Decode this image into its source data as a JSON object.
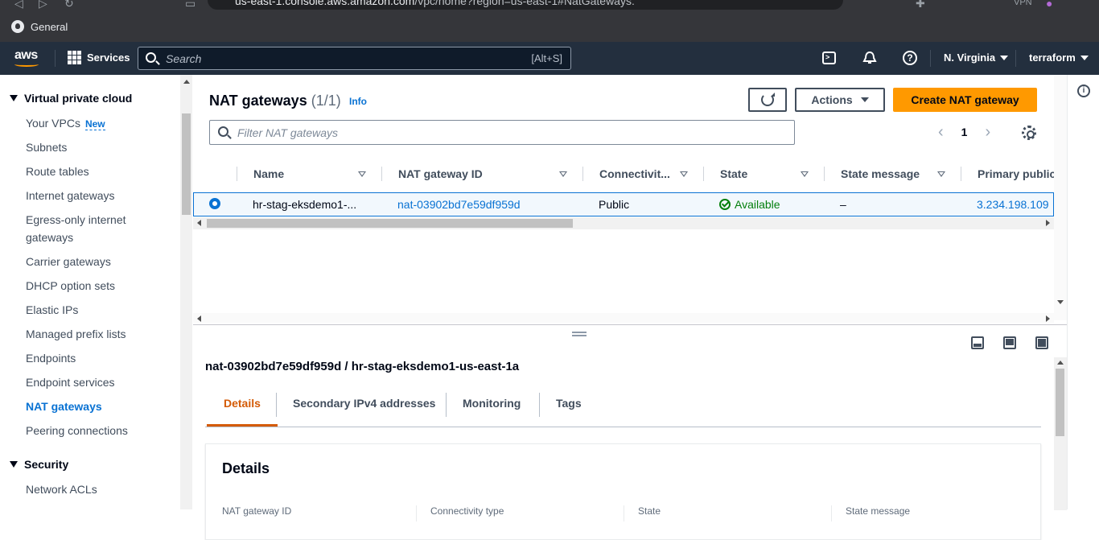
{
  "browser": {
    "url_host": "us-east-1.console.aws.amazon.com",
    "url_path": "/vpc/home?region=us-east-1#NatGateways:",
    "bookmark": "General",
    "vpn_label": "VPN"
  },
  "aws_nav": {
    "logo": "aws",
    "services": "Services",
    "search_placeholder": "Search",
    "search_shortcut": "[Alt+S]",
    "region": "N. Virginia",
    "account": "terraform"
  },
  "sidebar": {
    "section_vpc": "Virtual private cloud",
    "items": [
      {
        "label": "Your VPCs",
        "badge": "New"
      },
      {
        "label": "Subnets"
      },
      {
        "label": "Route tables"
      },
      {
        "label": "Internet gateways"
      },
      {
        "label": "Egress-only internet gateways"
      },
      {
        "label": "Carrier gateways"
      },
      {
        "label": "DHCP option sets"
      },
      {
        "label": "Elastic IPs"
      },
      {
        "label": "Managed prefix lists"
      },
      {
        "label": "Endpoints"
      },
      {
        "label": "Endpoint services"
      },
      {
        "label": "NAT gateways"
      },
      {
        "label": "Peering connections"
      }
    ],
    "section_security": "Security",
    "security_items": [
      {
        "label": "Network ACLs"
      }
    ]
  },
  "main": {
    "title": "NAT gateways",
    "count": "(1/1)",
    "info": "Info",
    "actions_label": "Actions",
    "create_label": "Create NAT gateway",
    "filter_placeholder": "Filter NAT gateways",
    "page_number": "1",
    "columns": [
      "Name",
      "NAT gateway ID",
      "Connectivit...",
      "State",
      "State message",
      "Primary public"
    ],
    "rows": [
      {
        "name": "hr-stag-eksdemo1-...",
        "id": "nat-03902bd7e59df959d",
        "connectivity": "Public",
        "state": "Available",
        "state_message": "–",
        "primary_public_ip": "3.234.198.109"
      }
    ]
  },
  "split_panel": {
    "title": "nat-03902bd7e59df959d / hr-stag-eksdemo1-us-east-1a",
    "tabs": [
      "Details",
      "Secondary IPv4 addresses",
      "Monitoring",
      "Tags"
    ],
    "card_title": "Details",
    "card_fields": [
      "NAT gateway ID",
      "Connectivity type",
      "State",
      "State message"
    ]
  },
  "colors": {
    "accent": "#0972d3",
    "primary_button": "#ff9900",
    "active_tab": "#d45b07",
    "success": "#037f0c",
    "nav_bg": "#232f3e"
  }
}
